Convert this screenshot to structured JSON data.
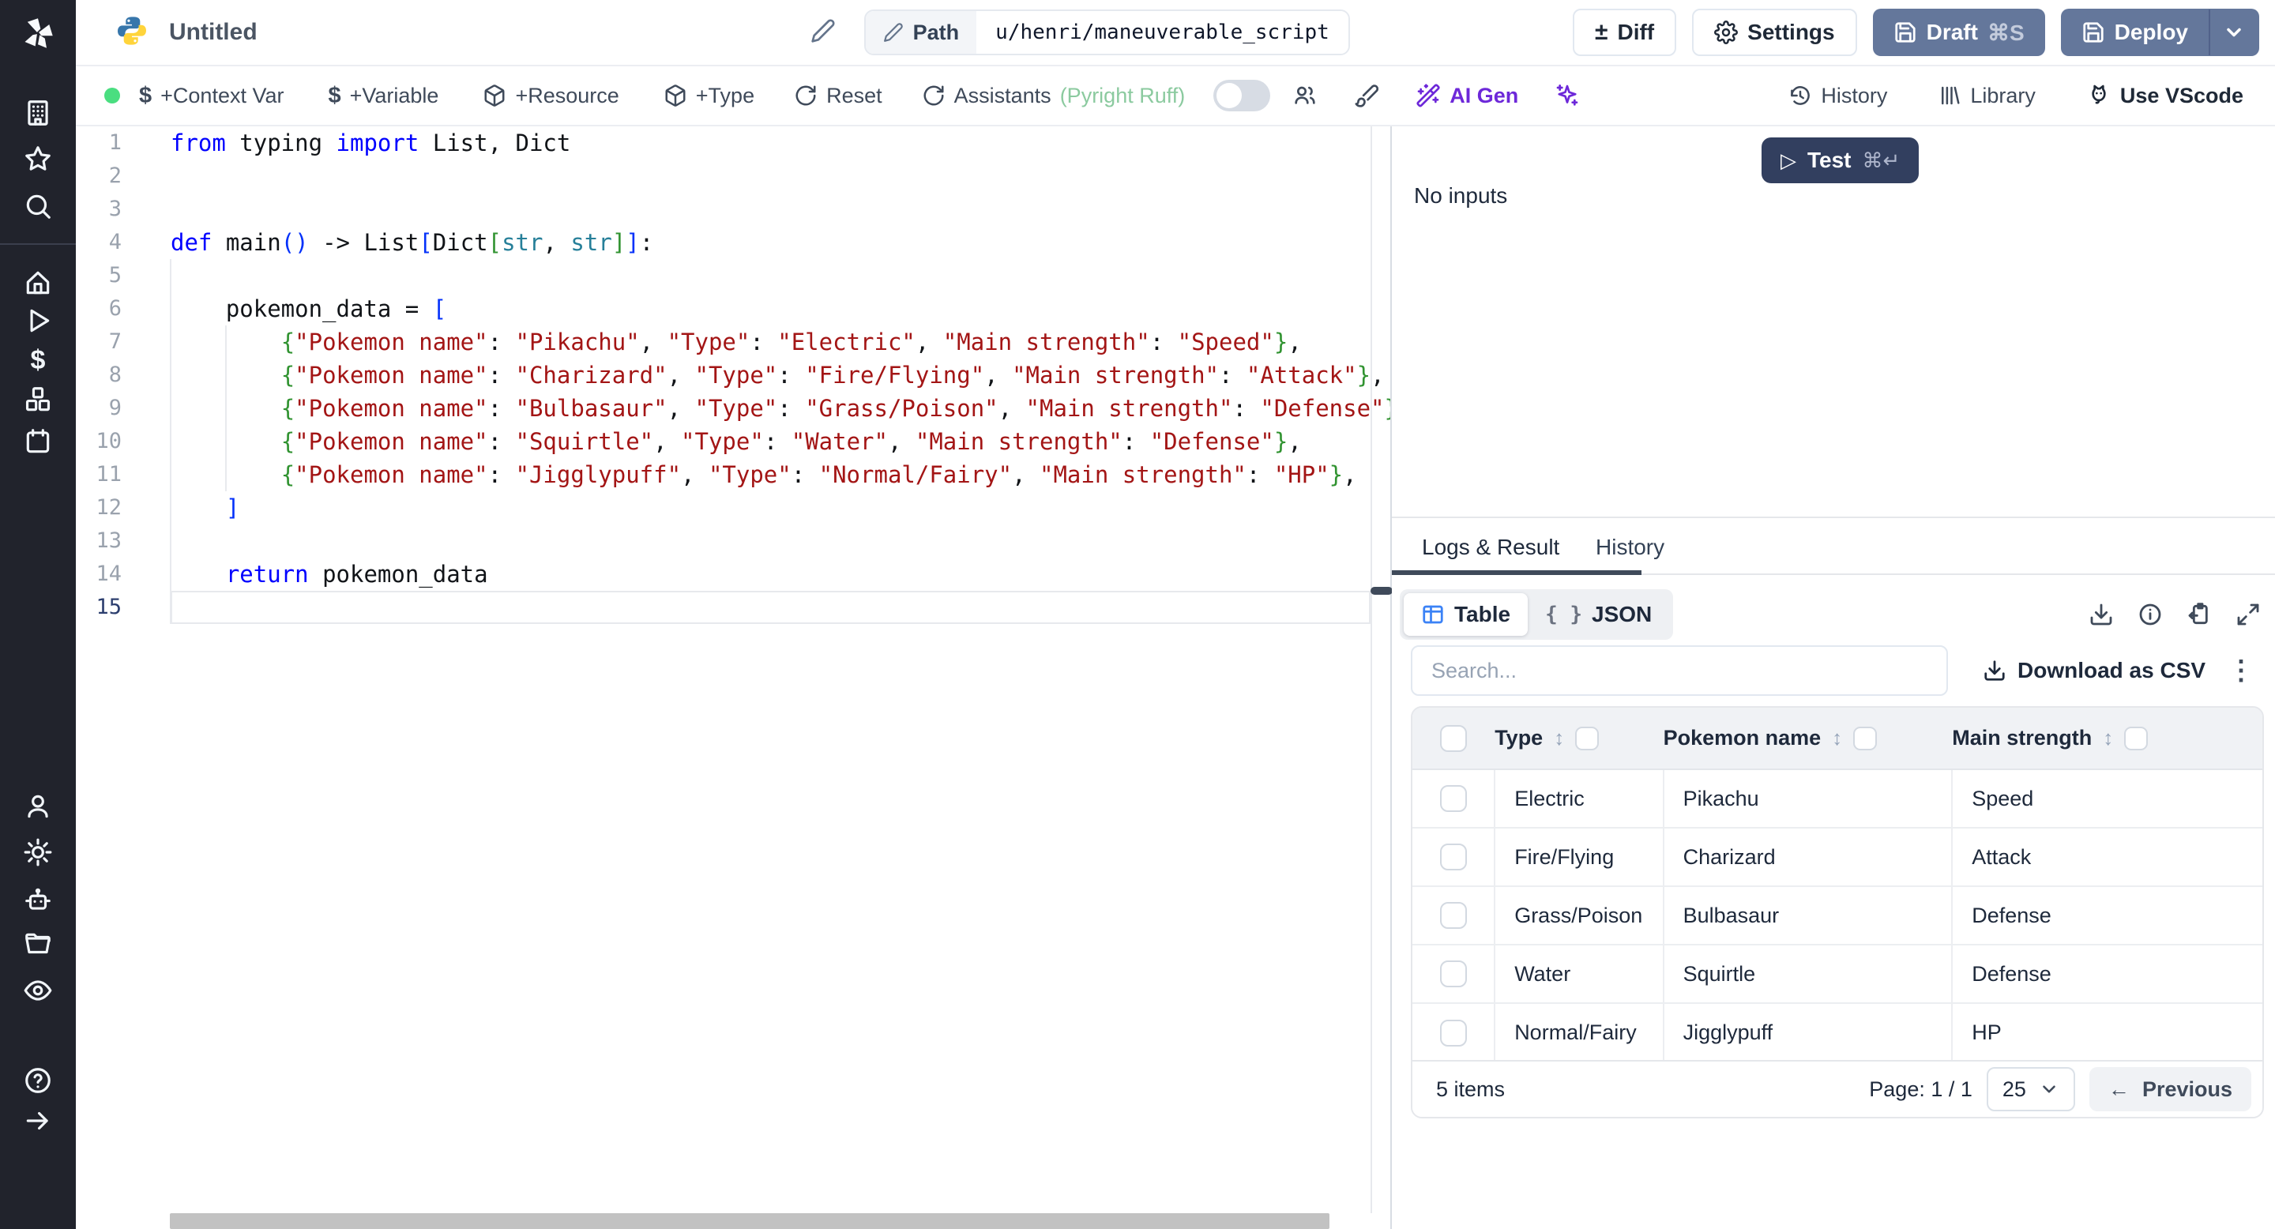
{
  "colors": {
    "rail_bg": "#21232c",
    "primary_button": "#64779b",
    "test_button": "#323f5f",
    "lang_ok_dot": "#4ade80",
    "assistants_status_green": "#8bca9f",
    "ai_purple": "#6d28d9",
    "table_icon_blue": "#3b82f6",
    "string_token": "#a31515",
    "keyword_token": "#0000ff"
  },
  "sidebar": {
    "icons": [
      "windmill-logo",
      "workspace",
      "favorites",
      "search",
      "home",
      "runs",
      "variables",
      "resources",
      "schedules",
      "users",
      "settings",
      "workers",
      "folders",
      "audit-logs",
      "help",
      "collapse"
    ]
  },
  "topbar": {
    "title": "Untitled",
    "path_label": "Path",
    "path_value": "u/henri/maneuverable_script",
    "diff_label": "Diff",
    "settings_label": "Settings",
    "draft_label": "Draft",
    "draft_shortcut": "⌘S",
    "deploy_label": "Deploy"
  },
  "toolbar": {
    "context_var": "+Context Var",
    "variable": "+Variable",
    "resource": "+Resource",
    "type": "+Type",
    "reset": "Reset",
    "assistants": "Assistants",
    "assistants_status": "(Pyright Ruff)",
    "ai_gen": "AI Gen",
    "history": "History",
    "library": "Library",
    "use_vscode": "Use VScode"
  },
  "icons": {
    "diff_plusminus": "±",
    "dollar": "$",
    "sort": "↕",
    "kebab": "⋮",
    "back_arrow": "←",
    "json_braces": "{ }",
    "play_outline": "▷",
    "help": "?"
  },
  "run_panel": {
    "test_label": "Test",
    "test_shortcut": "⌘↵",
    "no_inputs": "No inputs"
  },
  "result_panel": {
    "tabs": [
      {
        "label": "Logs & Result",
        "active": true
      },
      {
        "label": "History",
        "active": false
      }
    ],
    "view_toggle": {
      "table": "Table",
      "json": "JSON"
    },
    "search_placeholder": "Search...",
    "download_csv": "Download as CSV"
  },
  "result_table": {
    "columns": [
      "Type",
      "Pokemon name",
      "Main strength"
    ],
    "rows": [
      [
        "Electric",
        "Pikachu",
        "Speed"
      ],
      [
        "Fire/Flying",
        "Charizard",
        "Attack"
      ],
      [
        "Grass/Poison",
        "Bulbasaur",
        "Defense"
      ],
      [
        "Water",
        "Squirtle",
        "Defense"
      ],
      [
        "Normal/Fairy",
        "Jigglypuff",
        "HP"
      ]
    ],
    "footer": {
      "items": "5 items",
      "page": "Page: 1 / 1",
      "page_size": "25",
      "previous": "Previous"
    }
  },
  "editor": {
    "language": "python",
    "active_line": 15,
    "lines": [
      {
        "n": 1,
        "tokens": [
          [
            "k",
            "from"
          ],
          [
            "p",
            " typing "
          ],
          [
            "k",
            "import"
          ],
          [
            "p",
            " List, Dict"
          ]
        ]
      },
      {
        "n": 2,
        "tokens": []
      },
      {
        "n": 3,
        "tokens": []
      },
      {
        "n": 4,
        "tokens": [
          [
            "k",
            "def"
          ],
          [
            "p",
            " main"
          ],
          [
            "b1",
            "()"
          ],
          [
            "p",
            " -> List"
          ],
          [
            "b1",
            "["
          ],
          [
            "p",
            "Dict"
          ],
          [
            "b2",
            "["
          ],
          [
            "t",
            "str"
          ],
          [
            "p",
            ", "
          ],
          [
            "t",
            "str"
          ],
          [
            "b2",
            "]"
          ],
          [
            "b1",
            "]"
          ],
          [
            "p",
            ":"
          ]
        ]
      },
      {
        "n": 5,
        "tokens": []
      },
      {
        "n": 6,
        "tokens": [
          [
            "p",
            "    pokemon_data = "
          ],
          [
            "b1",
            "["
          ]
        ]
      },
      {
        "n": 7,
        "tokens": [
          [
            "p",
            "        "
          ],
          [
            "b2",
            "{"
          ],
          [
            "s",
            "\"Pokemon name\""
          ],
          [
            "p",
            ": "
          ],
          [
            "s",
            "\"Pikachu\""
          ],
          [
            "p",
            ", "
          ],
          [
            "s",
            "\"Type\""
          ],
          [
            "p",
            ": "
          ],
          [
            "s",
            "\"Electric\""
          ],
          [
            "p",
            ", "
          ],
          [
            "s",
            "\"Main strength\""
          ],
          [
            "p",
            ": "
          ],
          [
            "s",
            "\"Speed\""
          ],
          [
            "b2",
            "}"
          ],
          [
            "p",
            ","
          ]
        ]
      },
      {
        "n": 8,
        "tokens": [
          [
            "p",
            "        "
          ],
          [
            "b2",
            "{"
          ],
          [
            "s",
            "\"Pokemon name\""
          ],
          [
            "p",
            ": "
          ],
          [
            "s",
            "\"Charizard\""
          ],
          [
            "p",
            ", "
          ],
          [
            "s",
            "\"Type\""
          ],
          [
            "p",
            ": "
          ],
          [
            "s",
            "\"Fire/Flying\""
          ],
          [
            "p",
            ", "
          ],
          [
            "s",
            "\"Main strength\""
          ],
          [
            "p",
            ": "
          ],
          [
            "s",
            "\"Attack\""
          ],
          [
            "b2",
            "}"
          ],
          [
            "p",
            ","
          ]
        ]
      },
      {
        "n": 9,
        "tokens": [
          [
            "p",
            "        "
          ],
          [
            "b2",
            "{"
          ],
          [
            "s",
            "\"Pokemon name\""
          ],
          [
            "p",
            ": "
          ],
          [
            "s",
            "\"Bulbasaur\""
          ],
          [
            "p",
            ", "
          ],
          [
            "s",
            "\"Type\""
          ],
          [
            "p",
            ": "
          ],
          [
            "s",
            "\"Grass/Poison\""
          ],
          [
            "p",
            ", "
          ],
          [
            "s",
            "\"Main strength\""
          ],
          [
            "p",
            ": "
          ],
          [
            "s",
            "\"Defense\""
          ],
          [
            "b2",
            "}"
          ],
          [
            "p",
            ","
          ]
        ]
      },
      {
        "n": 10,
        "tokens": [
          [
            "p",
            "        "
          ],
          [
            "b2",
            "{"
          ],
          [
            "s",
            "\"Pokemon name\""
          ],
          [
            "p",
            ": "
          ],
          [
            "s",
            "\"Squirtle\""
          ],
          [
            "p",
            ", "
          ],
          [
            "s",
            "\"Type\""
          ],
          [
            "p",
            ": "
          ],
          [
            "s",
            "\"Water\""
          ],
          [
            "p",
            ", "
          ],
          [
            "s",
            "\"Main strength\""
          ],
          [
            "p",
            ": "
          ],
          [
            "s",
            "\"Defense\""
          ],
          [
            "b2",
            "}"
          ],
          [
            "p",
            ","
          ]
        ]
      },
      {
        "n": 11,
        "tokens": [
          [
            "p",
            "        "
          ],
          [
            "b2",
            "{"
          ],
          [
            "s",
            "\"Pokemon name\""
          ],
          [
            "p",
            ": "
          ],
          [
            "s",
            "\"Jigglypuff\""
          ],
          [
            "p",
            ", "
          ],
          [
            "s",
            "\"Type\""
          ],
          [
            "p",
            ": "
          ],
          [
            "s",
            "\"Normal/Fairy\""
          ],
          [
            "p",
            ", "
          ],
          [
            "s",
            "\"Main strength\""
          ],
          [
            "p",
            ": "
          ],
          [
            "s",
            "\"HP\""
          ],
          [
            "b2",
            "}"
          ],
          [
            "p",
            ","
          ]
        ]
      },
      {
        "n": 12,
        "tokens": [
          [
            "p",
            "    "
          ],
          [
            "b1",
            "]"
          ]
        ]
      },
      {
        "n": 13,
        "tokens": []
      },
      {
        "n": 14,
        "tokens": [
          [
            "p",
            "    "
          ],
          [
            "k",
            "return"
          ],
          [
            "p",
            " pokemon_data"
          ]
        ]
      },
      {
        "n": 15,
        "tokens": []
      }
    ]
  }
}
